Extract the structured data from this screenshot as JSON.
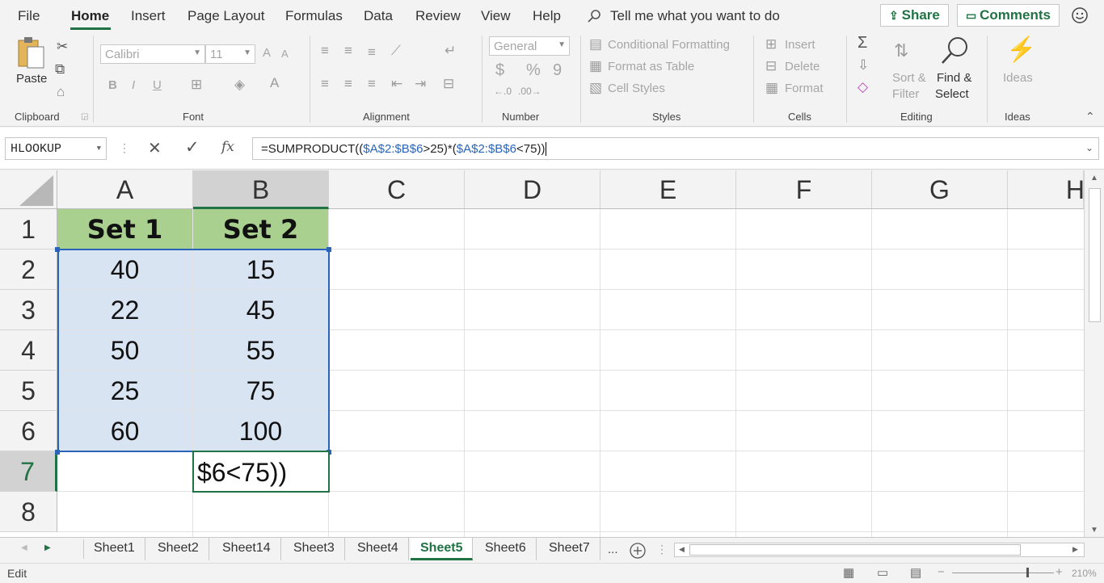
{
  "menu": {
    "tabs": [
      "File",
      "Home",
      "Insert",
      "Page Layout",
      "Formulas",
      "Data",
      "Review",
      "View",
      "Help"
    ],
    "tell_me": "Tell me what you want to do",
    "share": "Share",
    "comments": "Comments"
  },
  "ribbon": {
    "clipboard": {
      "paste": "Paste",
      "label": "Clipboard"
    },
    "font": {
      "name": "Calibri",
      "size": "11",
      "bold": "B",
      "italic": "I",
      "underline": "U",
      "grow": "A",
      "shrink": "A",
      "label": "Font"
    },
    "alignment": {
      "label": "Alignment"
    },
    "number": {
      "format": "General",
      "currency": "$",
      "percent": "%",
      "comma": "9",
      "label": "Number"
    },
    "styles": {
      "conditional": "Conditional Formatting",
      "table": "Format as Table",
      "cell": "Cell Styles",
      "label": "Styles"
    },
    "cells": {
      "insert": "Insert",
      "delete": "Delete",
      "format": "Format",
      "label": "Cells"
    },
    "editing": {
      "sort_line1": "Sort &",
      "sort_line2": "Filter",
      "find_line1": "Find &",
      "find_line2": "Select",
      "label": "Editing"
    },
    "ideas": {
      "button": "Ideas",
      "label": "Ideas"
    }
  },
  "formula_bar": {
    "name_box": "HLOOKUP",
    "cancel": "✕",
    "enter": "✓",
    "fx": "fx",
    "formula_parts": [
      "=SUMPRODUCT((",
      "$A$2:$B$6",
      ">25)*(",
      "$A$2:$B$6",
      "<75))"
    ]
  },
  "columns": [
    "A",
    "B",
    "C",
    "D",
    "E",
    "F",
    "G",
    "H"
  ],
  "rows": [
    "1",
    "2",
    "3",
    "4",
    "5",
    "6",
    "7",
    "8"
  ],
  "cells": {
    "A1": "Set 1",
    "B1": "Set 2",
    "A2": "40",
    "B2": "15",
    "A3": "22",
    "B3": "45",
    "A4": "50",
    "B4": "55",
    "A5": "25",
    "B5": "75",
    "A6": "60",
    "B6": "100",
    "B7": "$6<75))"
  },
  "sheets": [
    "Sheet1",
    "Sheet2",
    "Sheet14",
    "Sheet3",
    "Sheet4",
    "Sheet5",
    "Sheet6",
    "Sheet7"
  ],
  "active_sheet": "Sheet5",
  "sheet_more": "...",
  "status": {
    "mode": "Edit",
    "zoom": "210%"
  },
  "colors": {
    "accent": "#217346",
    "header_fill": "#a9d08e",
    "data_fill": "#d9e4f2",
    "ref_blue": "#2a64b8"
  }
}
